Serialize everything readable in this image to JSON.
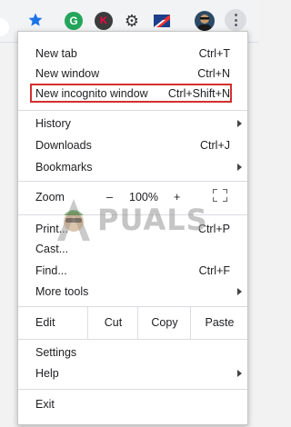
{
  "toolbar": {
    "extensions": [
      {
        "icon": "grammarly-icon",
        "glyph": "G",
        "color": "#23a55a"
      },
      {
        "icon": "k-extension-icon",
        "glyph": "K",
        "color": "#f04"
      },
      {
        "icon": "gear-extension-icon",
        "glyph": "⚙"
      },
      {
        "icon": "flag-extension-icon"
      }
    ]
  },
  "menu": {
    "new_tab": {
      "label": "New tab",
      "shortcut": "Ctrl+T"
    },
    "new_window": {
      "label": "New window",
      "shortcut": "Ctrl+N"
    },
    "new_incognito": {
      "label": "New incognito window",
      "shortcut": "Ctrl+Shift+N"
    },
    "history": {
      "label": "History"
    },
    "downloads": {
      "label": "Downloads",
      "shortcut": "Ctrl+J"
    },
    "bookmarks": {
      "label": "Bookmarks"
    },
    "zoom": {
      "label": "Zoom",
      "minus": "–",
      "value": "100%",
      "plus": "+"
    },
    "print": {
      "label": "Print...",
      "shortcut": "Ctrl+P"
    },
    "cast": {
      "label": "Cast..."
    },
    "find": {
      "label": "Find...",
      "shortcut": "Ctrl+F"
    },
    "more_tools": {
      "label": "More tools"
    },
    "edit": {
      "label": "Edit",
      "cut": "Cut",
      "copy": "Copy",
      "paste": "Paste"
    },
    "settings": {
      "label": "Settings"
    },
    "help": {
      "label": "Help"
    },
    "exit": {
      "label": "Exit"
    }
  },
  "watermark": {
    "text": "PUALS"
  },
  "colors": {
    "highlight": "#d32f2f",
    "star": "#1a73e8"
  }
}
